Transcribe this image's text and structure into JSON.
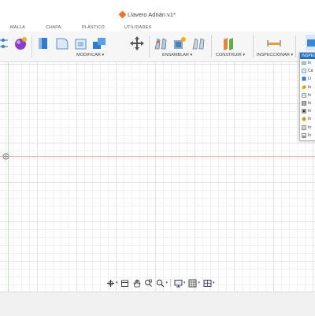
{
  "window": {
    "title": "Llavero Adrián v1*"
  },
  "tabs": [
    "MALLA",
    "CHAPA",
    "PLÁSTICO",
    "UTILIDADES"
  ],
  "groups": {
    "modificar": "MODIFICAR ▾",
    "ensamblar": "ENSAMBLAR ▾",
    "construir": "CONSTRUIR ▾",
    "inspeccionar": "INSPECCIONAR ▾"
  },
  "inspect_menu": {
    "header": "INSPECCIONAR",
    "items": [
      {
        "label": "In",
        "icon": "measure-icon"
      },
      {
        "label": "Ca",
        "icon": "component-color-icon"
      },
      {
        "label": "Li",
        "icon": "display-component-icon"
      },
      {
        "label": "In",
        "icon": "interference-icon"
      },
      {
        "label": "In",
        "icon": "curvature-comb-icon"
      },
      {
        "label": "In",
        "icon": "zebra-analysis-icon"
      },
      {
        "label": "In",
        "icon": "draft-analysis-icon"
      },
      {
        "label": "In",
        "icon": "curvature-map-icon"
      },
      {
        "label": "In",
        "icon": "isocurve-analysis-icon"
      },
      {
        "label": "In",
        "icon": "accessibility-analysis-icon"
      }
    ]
  },
  "colors": {
    "accent": "#1d6fc9",
    "x_axis": "#f3b1b1",
    "y_axis": "#bfe6bf",
    "title_icon": "#e8742a"
  }
}
